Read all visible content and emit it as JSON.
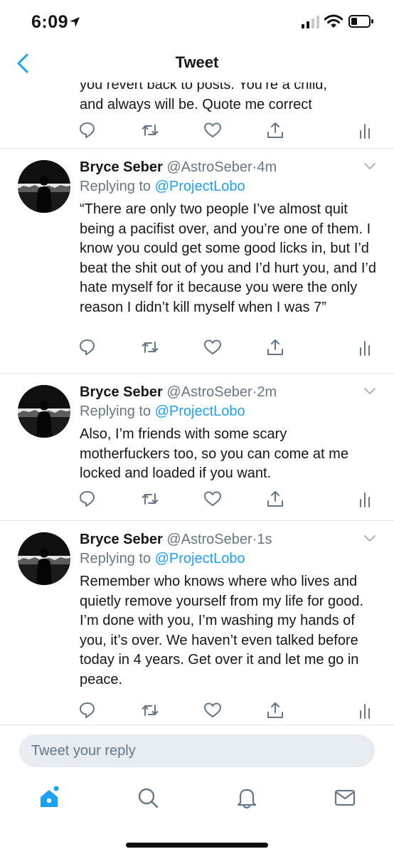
{
  "status_bar": {
    "time": "6:09",
    "signal_icon": "cellular-signal-icon",
    "wifi_icon": "wifi-icon",
    "battery_icon": "battery-low-icon"
  },
  "nav": {
    "title": "Tweet",
    "back_icon": "chevron-left-icon"
  },
  "colors": {
    "accent": "#1da1f2",
    "text": "#14171a",
    "muted": "#657786",
    "divider": "#e1e8ed",
    "input_bg": "#e6ecf0"
  },
  "previous_tweet": {
    "text": "you revert back to posts. You’re a child,\nand always will be. Quote me correct"
  },
  "tweets": [
    {
      "display_name": "Bryce Seber",
      "handle": "@AstroSeber",
      "separator": "·",
      "time": "4m",
      "reply_prefix": "Replying to",
      "reply_mention": "@ProjectLobo",
      "text": "“There are only two people I’ve almost quit being a pacifist over, and you’re one of them. I know you could get some good licks in, but I’d beat the shit out of you and I’d hurt you, and I’d hate myself for it because you were the only reason I didn’t kill myself when I was 7”"
    },
    {
      "display_name": "Bryce Seber",
      "handle": "@AstroSeber",
      "separator": "·",
      "time": "2m",
      "reply_prefix": "Replying to",
      "reply_mention": "@ProjectLobo",
      "text": "Also, I’m friends with some scary motherfuckers too, so you can come at me locked and loaded if you want."
    },
    {
      "display_name": "Bryce Seber",
      "handle": "@AstroSeber",
      "separator": "·",
      "time": "1s",
      "reply_prefix": "Replying to",
      "reply_mention": "@ProjectLobo",
      "text": "Remember who knows where who lives and quietly remove yourself from my life for good. I’m done with you, I’m washing my hands of you, it’s over. We haven’t even talked before today in 4 years. Get over it and let me go in peace."
    }
  ],
  "tweet_actions": [
    "reply-icon",
    "retweet-icon",
    "like-icon",
    "share-icon",
    "analytics-icon"
  ],
  "reply_box": {
    "placeholder": "Tweet your reply"
  },
  "tab_bar": [
    "home-icon",
    "search-icon",
    "notifications-icon",
    "messages-icon"
  ]
}
